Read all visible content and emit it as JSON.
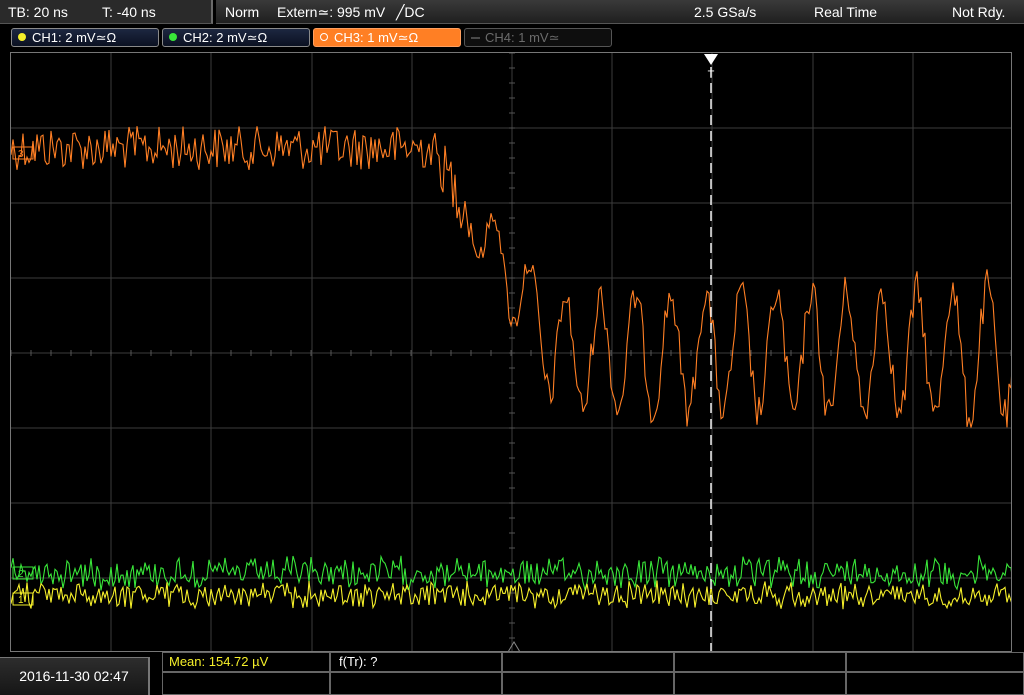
{
  "top_bar": {
    "timebase": "TB: 20 ns",
    "trigger_time": "T: -40 ns",
    "mode": "Norm",
    "trigger_source": "Extern≃: 995 mV",
    "trigger_slope": "╱DC",
    "sample_rate": "2.5 GSa/s",
    "acquisition": "Real Time",
    "status": "Not Rdy."
  },
  "channels": [
    {
      "label": "CH1: 2 mV≃Ω",
      "color": "#f5ef2a",
      "state": "on"
    },
    {
      "label": "CH2: 2 mV≃Ω",
      "color": "#39e639",
      "state": "on"
    },
    {
      "label": "CH3: 1 mV≃Ω",
      "color": "#ff7f24",
      "state": "selected"
    },
    {
      "label": "CH4: 1 mV≃",
      "color": "#6b6b6b",
      "state": "off"
    }
  ],
  "markers": {
    "ch3": "3",
    "ch2": "2",
    "ch1": "1",
    "trigger": "T"
  },
  "measurement": {
    "mean": "Mean: 154.72 µV",
    "rise_freq": "f(Tr): ?"
  },
  "datetime": "2016-11-30 02:47",
  "colors": {
    "ch1": "#f5ef2a",
    "ch2": "#39e639",
    "ch3": "#ff7f24",
    "grid": "#3c3c3c",
    "trigger_line": "#ffffff",
    "measure_label": "#f5ef2a"
  },
  "icons": {
    "trigger_marker": "triangle-down-icon",
    "center_marker": "triangle-up-icon"
  }
}
